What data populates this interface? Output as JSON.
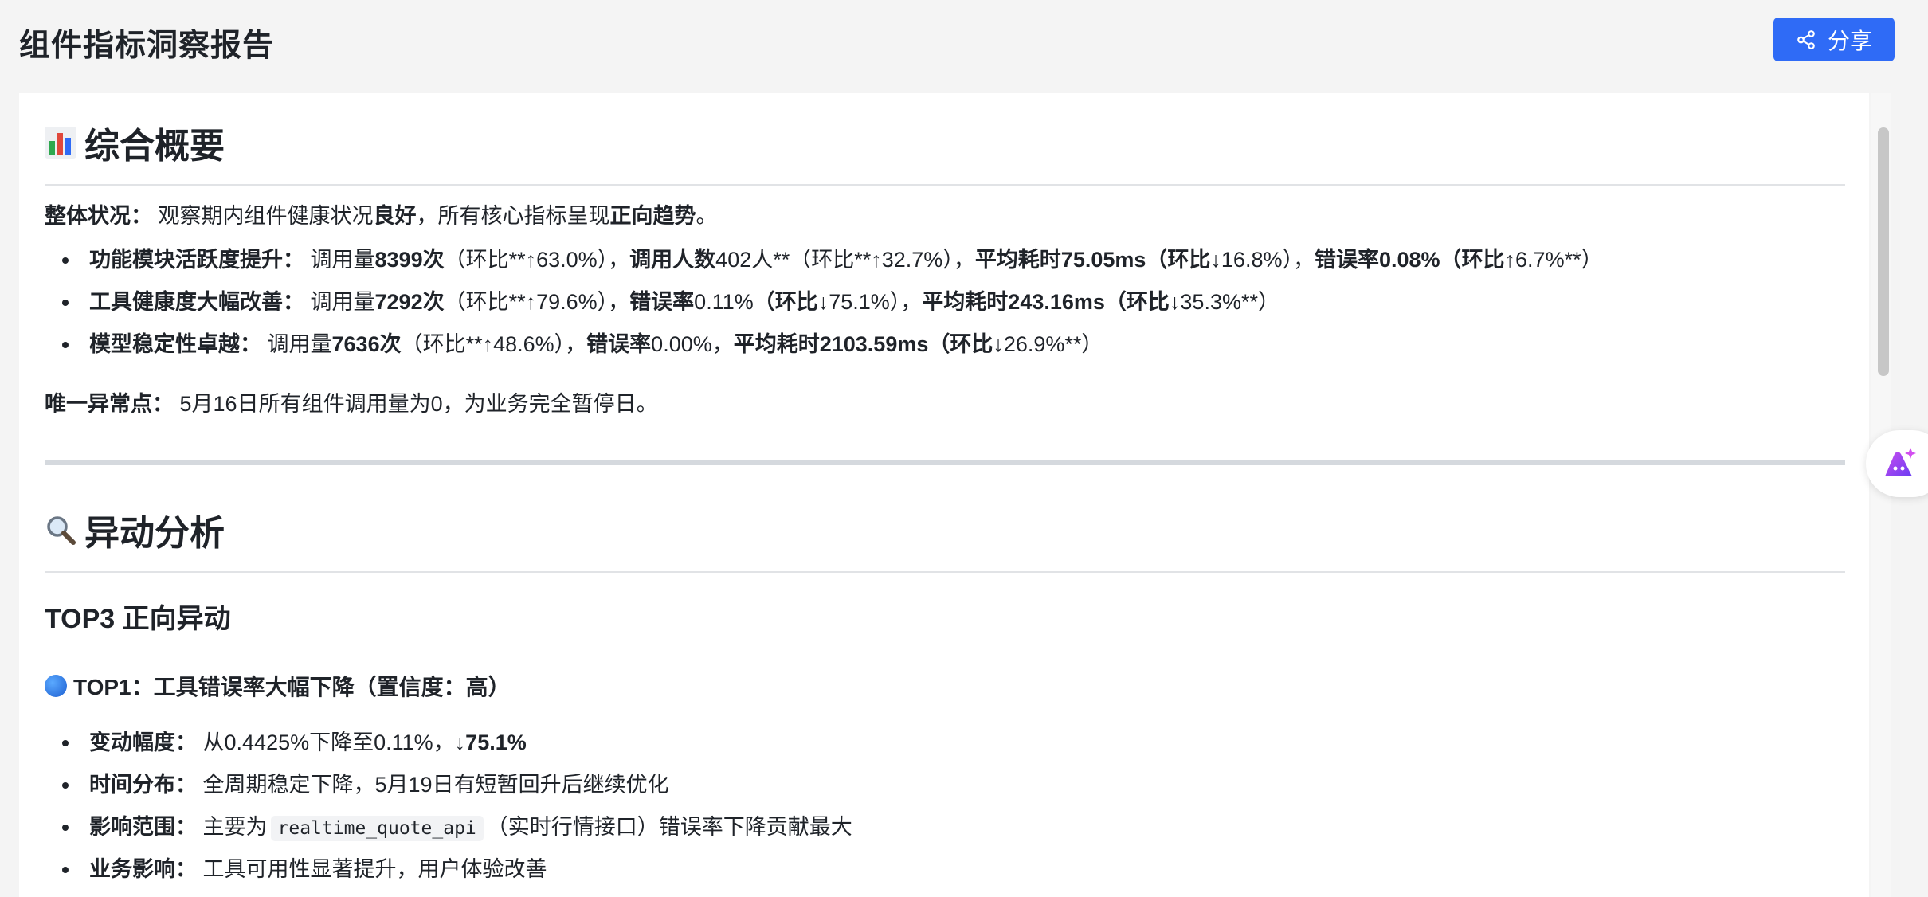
{
  "header": {
    "title": "组件指标洞察报告",
    "share_label": "分享"
  },
  "overview": {
    "heading": "综合概要",
    "status_label": "整体状况：",
    "status_pre": "观察期内组件健康状况",
    "status_good": "良好",
    "status_mid": "，所有核心指标呈现",
    "status_trend": "正向趋势",
    "status_end": "。",
    "items": [
      {
        "label": "功能模块活跃度提升：",
        "parts": [
          "调用量",
          "8399次",
          "（环比**↑63.0%），",
          "调用人数",
          "402人**（环比**↑32.7%），",
          "平均耗时75.05ms（环比",
          "↓16.8%），",
          "错误率0.08%（环比",
          "↑6.7%**）"
        ]
      },
      {
        "label": "工具健康度大幅改善：",
        "parts": [
          "调用量",
          "7292次",
          "（环比**↑79.6%），",
          "错误率",
          "0.11%",
          "（环比",
          "↓75.1%），",
          "平均耗时243.16ms（环比",
          "↓35.3%**）"
        ]
      },
      {
        "label": "模型稳定性卓越：",
        "parts": [
          "调用量",
          "7636次",
          "（环比**↑48.6%），",
          "错误率",
          "0.00%，",
          "平均耗时2103.59ms（环比",
          "↓26.9%**）"
        ]
      }
    ],
    "anomaly_label": "唯一异常点：",
    "anomaly_text": "5月16日所有组件调用量为0，为业务完全暂停日。"
  },
  "analysis": {
    "heading": "异动分析",
    "subheading": "TOP3 正向异动",
    "top1_title": "TOP1：工具错误率大幅下降（置信度：高）",
    "details": [
      {
        "label": "变动幅度：",
        "text": "从0.4425%下降至0.11%，",
        "bold": "↓75.1%"
      },
      {
        "label": "时间分布：",
        "text": "全周期稳定下降，5月19日有短暂回升后继续优化",
        "bold": ""
      },
      {
        "label": "影响范围：",
        "text_pre": "主要为",
        "code": "realtime_quote_api",
        "text_post": "（实时行情接口）错误率下降贡献最大"
      },
      {
        "label": "业务影响：",
        "text": "工具可用性显著提升，用户体验改善",
        "bold": ""
      }
    ]
  }
}
